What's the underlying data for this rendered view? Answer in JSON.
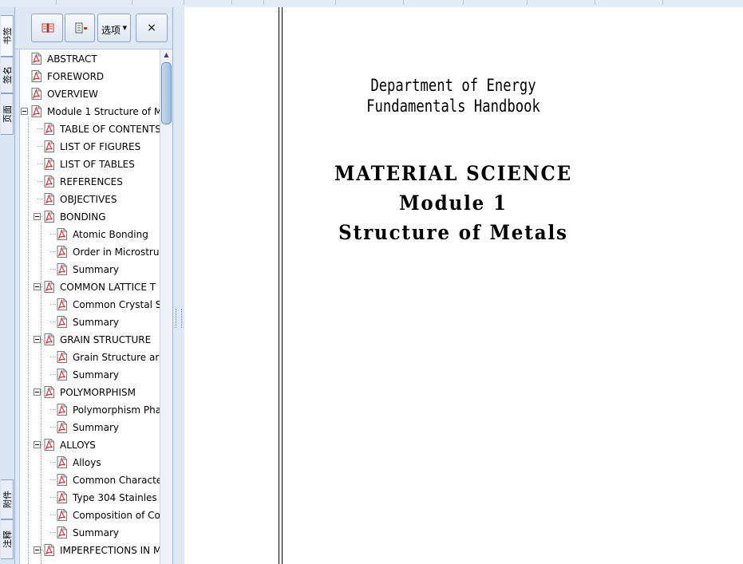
{
  "side_tabs": {
    "bookmarks": "书签",
    "signatures": "签名",
    "pages": "页面",
    "attachments": "附件",
    "annotations": "注释"
  },
  "toolbar": {
    "options_label": "选项",
    "close_glyph": "×"
  },
  "icons": {
    "bookmark_tool": "bookmark-book-icon",
    "expand_tool": "bookmark-expand-icon",
    "pdf_item": "pdf-document-icon"
  },
  "colors": {
    "panel_bg": "#dfe8f5",
    "pdf_red": "#d12a2a"
  },
  "tree": [
    {
      "label": "ABSTRACT",
      "level": 0,
      "expander": false
    },
    {
      "label": "FOREWORD",
      "level": 0,
      "expander": false
    },
    {
      "label": "OVERVIEW",
      "level": 0,
      "expander": false
    },
    {
      "label": "Module 1 Structure of M",
      "level": 0,
      "expander": true
    },
    {
      "label": "TABLE OF CONTENTS",
      "level": 1,
      "expander": false
    },
    {
      "label": "LIST OF FIGURES",
      "level": 1,
      "expander": false
    },
    {
      "label": "LIST OF  TABLES",
      "level": 1,
      "expander": false
    },
    {
      "label": "REFERENCES",
      "level": 1,
      "expander": false
    },
    {
      "label": "OBJECTIVES",
      "level": 1,
      "expander": false
    },
    {
      "label": "BONDING",
      "level": 1,
      "expander": true
    },
    {
      "label": "Atomic Bonding",
      "level": 2,
      "expander": false
    },
    {
      "label": "Order in Microstru",
      "level": 2,
      "expander": false
    },
    {
      "label": "Summary",
      "level": 2,
      "expander": false
    },
    {
      "label": "COMMON LATTICE T",
      "level": 1,
      "expander": true
    },
    {
      "label": "Common Crystal S",
      "level": 2,
      "expander": false
    },
    {
      "label": "Summary",
      "level": 2,
      "expander": false
    },
    {
      "label": "GRAIN STRUCTURE",
      "level": 1,
      "expander": true
    },
    {
      "label": "Grain Structure ar",
      "level": 2,
      "expander": false
    },
    {
      "label": "Summary",
      "level": 2,
      "expander": false
    },
    {
      "label": "POLYMORPHISM",
      "level": 1,
      "expander": true
    },
    {
      "label": "Polymorphism Pha",
      "level": 2,
      "expander": false
    },
    {
      "label": "Summary",
      "level": 2,
      "expander": false
    },
    {
      "label": "ALLOYS",
      "level": 1,
      "expander": true
    },
    {
      "label": "Alloys",
      "level": 2,
      "expander": false
    },
    {
      "label": "Common Characte",
      "level": 2,
      "expander": false
    },
    {
      "label": "Type 304 Stainles",
      "level": 2,
      "expander": false
    },
    {
      "label": "Composition of Co",
      "level": 2,
      "expander": false
    },
    {
      "label": "Summary",
      "level": 2,
      "expander": false
    },
    {
      "label": "IMPERFECTIONS IN M",
      "level": 1,
      "expander": true
    }
  ],
  "document": {
    "handbook_line1": "Department of Energy",
    "handbook_line2": "Fundamentals Handbook",
    "title_line1": "MATERIAL SCIENCE",
    "title_line2": "Module 1",
    "title_line3": "Structure of Metals"
  }
}
